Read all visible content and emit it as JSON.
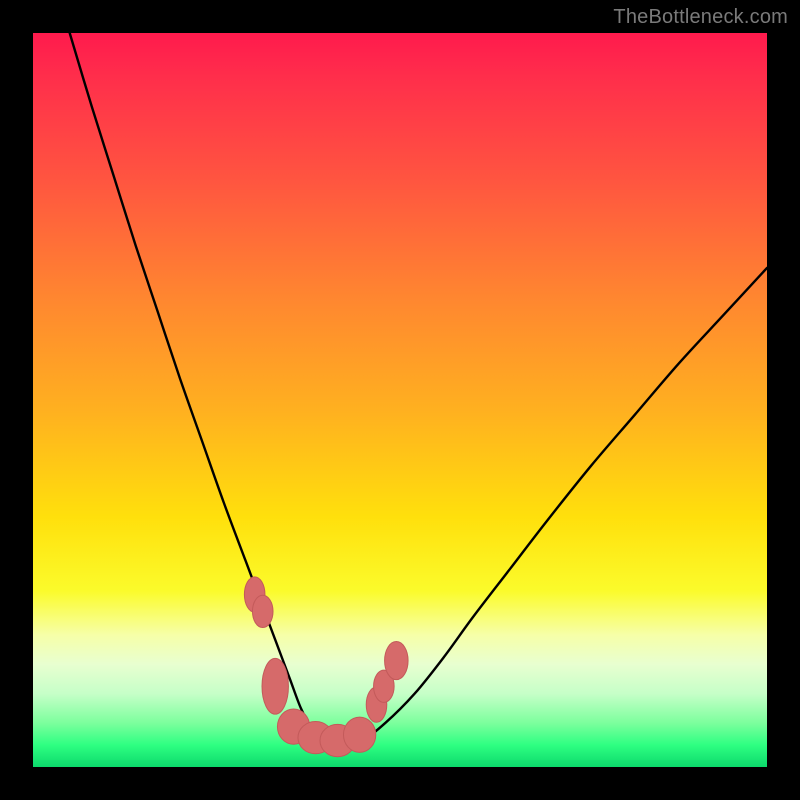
{
  "watermark": "TheBottleneck.com",
  "colors": {
    "background_frame": "#000000",
    "gradient_top": "#ff1a4d",
    "gradient_mid_1": "#ff8630",
    "gradient_mid_2": "#ffe00c",
    "gradient_bottom": "#0cd96c",
    "curve_stroke": "#000000",
    "marker_fill": "#d66a6a",
    "marker_stroke": "#c35a5a"
  },
  "chart_data": {
    "type": "line",
    "title": "",
    "xlabel": "",
    "ylabel": "",
    "xlim": [
      0,
      100
    ],
    "ylim": [
      0,
      100
    ],
    "grid": false,
    "legend": false,
    "series": [
      {
        "name": "bottleneck-curve",
        "x": [
          5,
          8,
          11,
          14,
          17,
          20,
          23,
          26,
          29,
          32,
          33.5,
          35,
          36.5,
          38,
          39.5,
          42,
          45,
          48,
          52,
          56,
          60,
          65,
          70,
          76,
          82,
          88,
          94,
          100
        ],
        "y": [
          100,
          90,
          80.5,
          71,
          62,
          53,
          44.5,
          36,
          28,
          20,
          16,
          12,
          8,
          5.2,
          3.8,
          3.4,
          3.8,
          6,
          10,
          15,
          20.5,
          27,
          33.5,
          41,
          48,
          55,
          61.5,
          68
        ]
      }
    ],
    "markers": [
      {
        "x": 30.2,
        "y": 23.5,
        "rx": 1.4,
        "ry": 2.4
      },
      {
        "x": 31.3,
        "y": 21.2,
        "rx": 1.4,
        "ry": 2.2
      },
      {
        "x": 33.0,
        "y": 11.0,
        "rx": 1.8,
        "ry": 3.8
      },
      {
        "x": 35.5,
        "y": 5.5,
        "rx": 2.2,
        "ry": 2.4
      },
      {
        "x": 38.5,
        "y": 4.0,
        "rx": 2.4,
        "ry": 2.2
      },
      {
        "x": 41.5,
        "y": 3.6,
        "rx": 2.4,
        "ry": 2.2
      },
      {
        "x": 44.5,
        "y": 4.4,
        "rx": 2.2,
        "ry": 2.4
      },
      {
        "x": 46.8,
        "y": 8.5,
        "rx": 1.4,
        "ry": 2.4
      },
      {
        "x": 47.8,
        "y": 11.0,
        "rx": 1.4,
        "ry": 2.2
      },
      {
        "x": 49.5,
        "y": 14.5,
        "rx": 1.6,
        "ry": 2.6
      }
    ]
  }
}
